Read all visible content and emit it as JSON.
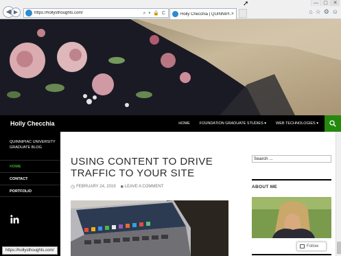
{
  "browser": {
    "url": "https://hollysthoughts.com/",
    "tab_title": "Holly Checchia | QUINNIPI...",
    "tab_close": "×",
    "address_tools": "⌕ ▾ 🔒 C",
    "status_url": "https://hollysthoughts.com/",
    "window_controls": [
      "—",
      "▢",
      "✕"
    ],
    "right_icons": [
      "home-icon",
      "star-icon",
      "gear-icon",
      "smiley-icon"
    ]
  },
  "site": {
    "title": "Holly Checchia",
    "top_menu": [
      {
        "label": "HOME"
      },
      {
        "label": "FOUNDATION GRADUATE STUDIES ▾"
      },
      {
        "label": "WEB TECHNOLOGIES ▾"
      }
    ],
    "tagline": "QUINNIPIAC UNIVERSITY GRADUATE BLOG",
    "left_nav": [
      {
        "label": "HOME",
        "active": true
      },
      {
        "label": "CONTACT",
        "active": false
      },
      {
        "label": "PORTFOLIO",
        "active": false
      }
    ]
  },
  "post": {
    "title": "USING CONTENT TO DRIVE TRAFFIC TO YOUR SITE",
    "date": "FEBRUARY 24, 2019",
    "comment_link": "LEAVE A COMMENT"
  },
  "sidebar": {
    "search_placeholder": "Search ...",
    "about_title": "ABOUT ME"
  },
  "follow_label": "Follow",
  "colors": {
    "accent_green": "#24890d",
    "nav_bg": "#000000",
    "active_link": "#41a62a"
  }
}
